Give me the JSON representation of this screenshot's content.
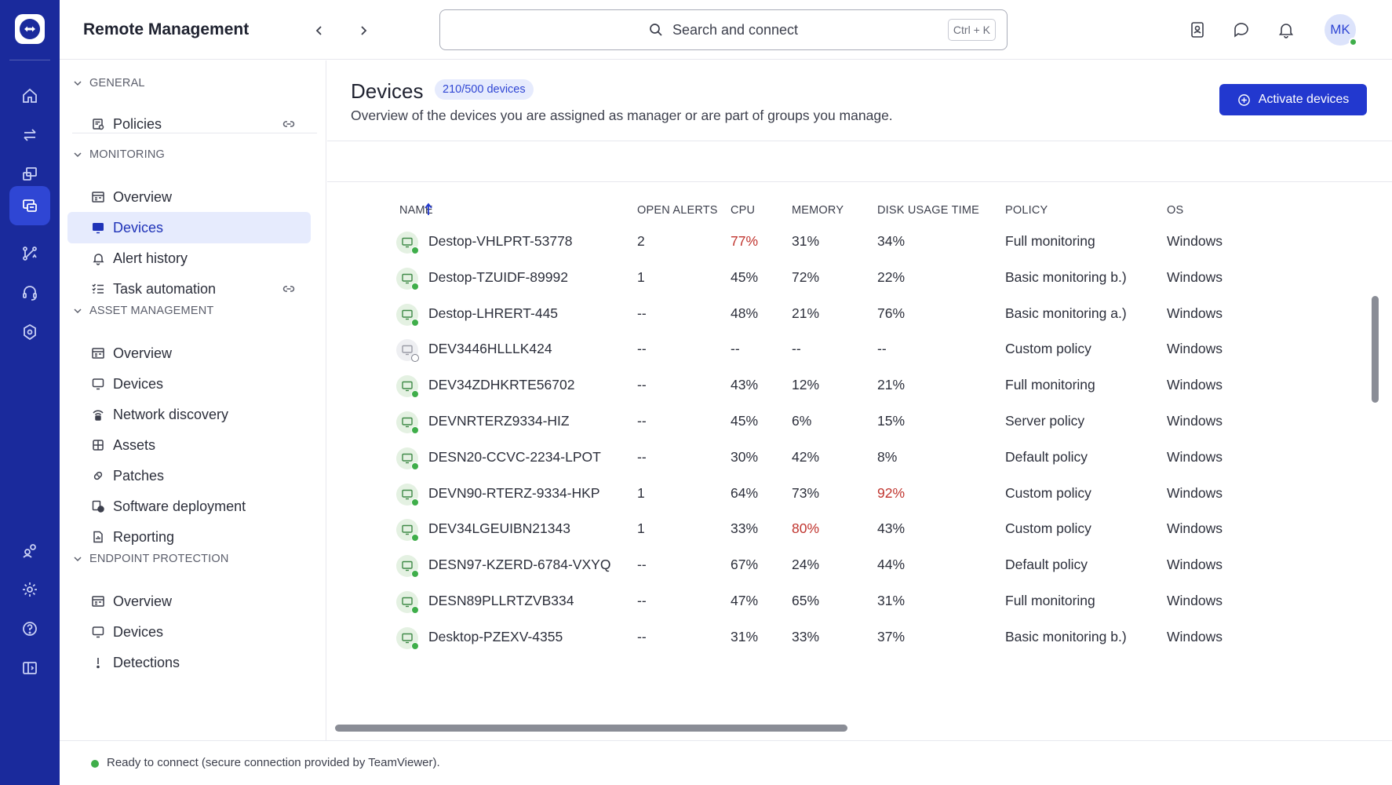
{
  "colors": {
    "rail": "#1a2a9c",
    "accent": "#2238cf",
    "active_bg": "#e6ebfd",
    "online": "#3fae4a",
    "alert": "#c0342e"
  },
  "header": {
    "title": "Remote Management",
    "search_placeholder": "Search and connect",
    "search_shortcut": "Ctrl + K",
    "avatar_initials": "MK"
  },
  "rail": {
    "icons": [
      "home-icon",
      "transfer-icon",
      "remote-device-icon",
      "devices-management-icon",
      "connections-icon",
      "support-headset-icon",
      "security-shield-icon",
      "users-icon",
      "settings-gear-icon",
      "help-icon",
      "collapse-panel-icon"
    ]
  },
  "sidebar": {
    "sections": [
      {
        "title": "GENERAL",
        "items": [
          {
            "label": "Policies",
            "icon": "policy-icon",
            "external": true
          }
        ]
      },
      {
        "title": "MONITORING",
        "items": [
          {
            "label": "Overview",
            "icon": "overview-icon"
          },
          {
            "label": "Devices",
            "icon": "monitor-icon",
            "active": true
          },
          {
            "label": "Alert history",
            "icon": "alert-history-icon"
          },
          {
            "label": "Task automation",
            "icon": "task-list-icon",
            "external": true
          }
        ]
      },
      {
        "title": "ASSET MANAGEMENT",
        "items": [
          {
            "label": "Overview",
            "icon": "overview-icon"
          },
          {
            "label": "Devices",
            "icon": "monitor-icon"
          },
          {
            "label": "Network discovery",
            "icon": "network-icon"
          },
          {
            "label": "Assets",
            "icon": "assets-grid-icon"
          },
          {
            "label": "Patches",
            "icon": "patch-icon"
          },
          {
            "label": "Software deployment",
            "icon": "deploy-icon"
          },
          {
            "label": "Reporting",
            "icon": "report-icon"
          }
        ]
      },
      {
        "title": "ENDPOINT PROTECTION",
        "items": [
          {
            "label": "Overview",
            "icon": "overview-icon"
          },
          {
            "label": "Devices",
            "icon": "monitor-icon"
          },
          {
            "label": "Detections",
            "icon": "detection-icon"
          }
        ]
      }
    ]
  },
  "main": {
    "title": "Devices",
    "count_badge": "210/500 devices",
    "subtitle": "Overview of the devices you are assigned as manager or are part of groups you manage.",
    "activate_button": "Activate devices",
    "columns": [
      "NAME",
      "OPEN ALERTS",
      "CPU",
      "MEMORY",
      "DISK USAGE TIME",
      "POLICY",
      "OS"
    ],
    "rows": [
      {
        "name": "Destop-VHLPRT-53778",
        "alerts": "2",
        "cpu": "77%",
        "memory": "31%",
        "disk": "34%",
        "policy": "Full monitoring",
        "os": "Windows",
        "online": true,
        "cpu_warn": true
      },
      {
        "name": "Destop-TZUIDF-89992",
        "alerts": "1",
        "cpu": "45%",
        "memory": "72%",
        "disk": "22%",
        "policy": "Basic monitoring b.)",
        "os": "Windows",
        "online": true
      },
      {
        "name": "Destop-LHRERT-445",
        "alerts": "--",
        "cpu": "48%",
        "memory": "21%",
        "disk": "76%",
        "policy": "Basic monitoring a.)",
        "os": "Windows",
        "online": true
      },
      {
        "name": "DEV3446HLLLK424",
        "alerts": "--",
        "cpu": "--",
        "memory": "--",
        "disk": "--",
        "policy": "Custom policy",
        "os": "Windows",
        "online": false
      },
      {
        "name": "DEV34ZDHKRTE56702",
        "alerts": "--",
        "cpu": "43%",
        "memory": "12%",
        "disk": "21%",
        "policy": "Full monitoring",
        "os": "Windows",
        "online": true
      },
      {
        "name": "DEVNRTERZ9334-HIZ",
        "alerts": "--",
        "cpu": "45%",
        "memory": "6%",
        "disk": "15%",
        "policy": "Server policy",
        "os": "Windows",
        "online": true
      },
      {
        "name": "DESN20-CCVC-2234-LPOT",
        "alerts": "--",
        "cpu": "30%",
        "memory": "42%",
        "disk": "8%",
        "policy": "Default policy",
        "os": "Windows",
        "online": true
      },
      {
        "name": "DEVN90-RTERZ-9334-HKP",
        "alerts": "1",
        "cpu": "64%",
        "memory": "73%",
        "disk": "92%",
        "policy": "Custom policy",
        "os": "Windows",
        "online": true,
        "disk_warn": true
      },
      {
        "name": "DEV34LGEUIBN21343",
        "alerts": "1",
        "cpu": "33%",
        "memory": "80%",
        "disk": "43%",
        "policy": "Custom policy",
        "os": "Windows",
        "online": true,
        "memory_warn": true
      },
      {
        "name": "DESN97-KZERD-6784-VXYQ",
        "alerts": "--",
        "cpu": "67%",
        "memory": "24%",
        "disk": "44%",
        "policy": "Default policy",
        "os": "Windows",
        "online": true
      },
      {
        "name": "DESN89PLLRTZVB334",
        "alerts": "--",
        "cpu": "47%",
        "memory": "65%",
        "disk": "31%",
        "policy": "Full monitoring",
        "os": "Windows",
        "online": true
      },
      {
        "name": "Desktop-PZEXV-4355",
        "alerts": "--",
        "cpu": "31%",
        "memory": "33%",
        "disk": "37%",
        "policy": "Basic monitoring b.)",
        "os": "Windows",
        "online": true
      }
    ]
  },
  "status": {
    "text": "Ready to connect (secure connection provided by TeamViewer)."
  }
}
